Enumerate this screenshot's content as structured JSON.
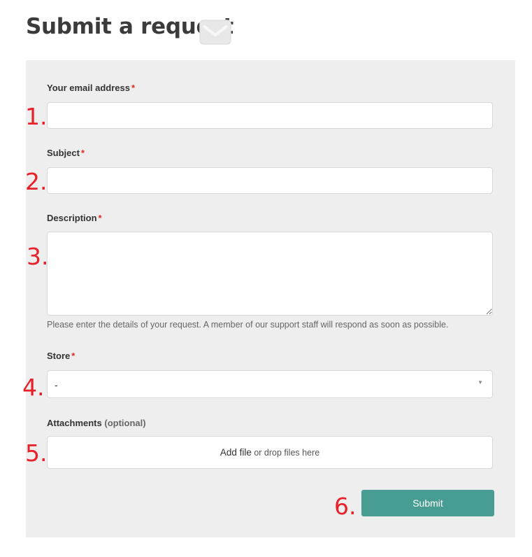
{
  "page": {
    "title": "Submit a request"
  },
  "fields": {
    "email": {
      "label": "Your email address",
      "required_mark": "*",
      "value": ""
    },
    "subject": {
      "label": "Subject",
      "required_mark": "*",
      "value": ""
    },
    "description": {
      "label": "Description",
      "required_mark": "*",
      "value": "",
      "hint": "Please enter the details of your request. A member of our support staff will respond as soon as possible."
    },
    "store": {
      "label": "Store",
      "required_mark": "*",
      "selected": "-",
      "arrow": "▼"
    },
    "attachments": {
      "label": "Attachments",
      "optional": "(optional)",
      "add_file": "Add file",
      "drop_text": "or drop files here"
    }
  },
  "submit": {
    "label": "Submit"
  },
  "annotations": [
    "1.",
    "2.",
    "3.",
    "4.",
    "5.",
    "6."
  ],
  "colors": {
    "accent": "#489d93",
    "required": "#e22a2a",
    "annotation": "#e8202a",
    "panel": "#eeeeee"
  },
  "icons": {
    "title": "envelope-icon"
  }
}
